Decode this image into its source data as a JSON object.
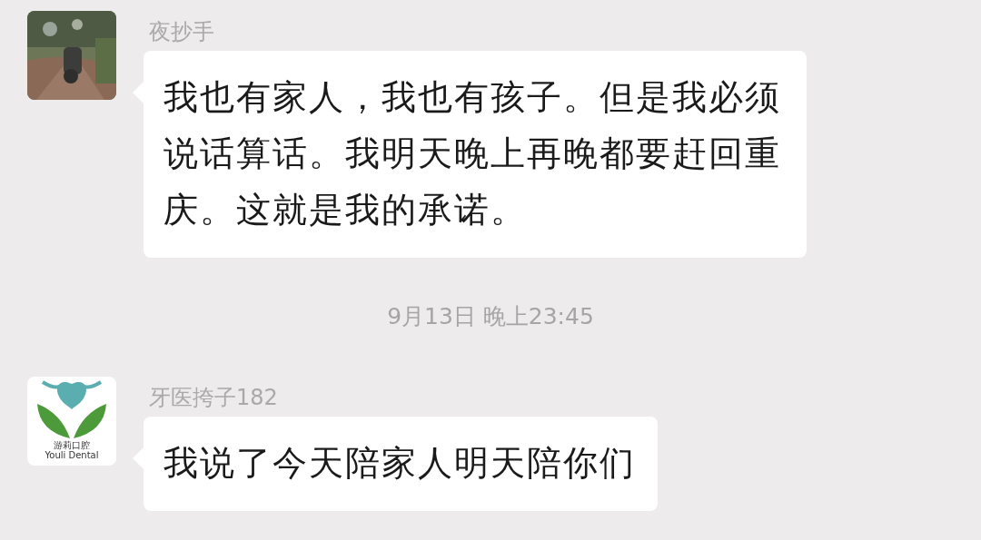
{
  "messages": [
    {
      "kind": "message",
      "sender": "夜抄手",
      "text": "我也有家人，我也有孩子。但是我必须说话算话。我明天晚上再晚都要赶回重庆。这就是我的承诺。"
    },
    {
      "kind": "timestamp",
      "text": "9月13日 晚上23:45"
    },
    {
      "kind": "message",
      "avatar": {
        "kind": "logo",
        "logo_text": "游莉口腔",
        "logo_subtext": "Youli Dental"
      },
      "sender": "牙医挎子182",
      "text": "我说了今天陪家人明天陪你们"
    }
  ]
}
